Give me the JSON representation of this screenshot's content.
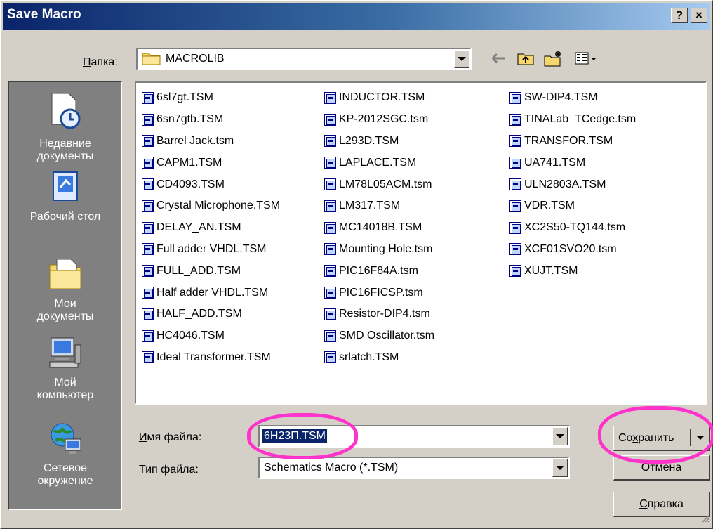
{
  "window": {
    "title": "Save Macro",
    "help_btn": "?",
    "close_btn": "×"
  },
  "folder": {
    "label_u": "П",
    "label_rest": "апка:",
    "value": "MACROLIB"
  },
  "toolbar": {
    "back_icon": "back-arrow-icon",
    "up_icon": "up-folder-icon",
    "new_folder_icon": "new-folder-icon",
    "view_icon": "view-menu-icon"
  },
  "places": [
    {
      "label_line1": "Недавние",
      "label_line2": "документы",
      "icon": "recent-documents-icon"
    },
    {
      "label_line1": "Рабочий стол",
      "label_line2": "",
      "icon": "desktop-icon"
    },
    {
      "label_line1": "Мои",
      "label_line2": "документы",
      "icon": "my-documents-icon"
    },
    {
      "label_line1": "Мой",
      "label_line2": "компьютер",
      "icon": "my-computer-icon"
    },
    {
      "label_line1": "Сетевое",
      "label_line2": "окружение",
      "icon": "network-icon"
    }
  ],
  "files": {
    "col1": [
      "6sl7gt.TSM",
      "6sn7gtb.TSM",
      "Barrel Jack.tsm",
      "CAPM1.TSM",
      "CD4093.TSM",
      "Crystal Microphone.TSM",
      "DELAY_AN.TSM",
      "Full adder VHDL.TSM",
      "FULL_ADD.TSM",
      "Half adder VHDL.TSM",
      "HALF_ADD.TSM",
      "HC4046.TSM",
      "Ideal Transformer.TSM"
    ],
    "col2": [
      "INDUCTOR.TSM",
      "KP-2012SGC.tsm",
      "L293D.TSM",
      "LAPLACE.TSM",
      "LM78L05ACM.tsm",
      "LM317.TSM",
      "MC14018B.TSM",
      "Mounting Hole.tsm",
      "PIC16F84A.tsm",
      "PIC16FICSP.tsm",
      "Resistor-DIP4.tsm",
      "SMD Oscillator.tsm",
      "srlatch.TSM"
    ],
    "col3": [
      "SW-DIP4.TSM",
      "TINALab_TCedge.tsm",
      "TRANSFOR.TSM",
      "UA741.TSM",
      "ULN2803A.TSM",
      "VDR.TSM",
      "XC2S50-TQ144.tsm",
      "XCF01SVO20.tsm",
      "XUJT.TSM"
    ]
  },
  "filename": {
    "label_u": "И",
    "label_rest": "мя файла:",
    "value": "6H23П.TSM"
  },
  "filetype": {
    "label_u": "Т",
    "label_rest": "ип файла:",
    "value": "Schematics Macro (*.TSM)"
  },
  "buttons": {
    "save_pre": "Со",
    "save_u": "х",
    "save_post": "ранить",
    "cancel": "Отмена",
    "help_u": "С",
    "help_rest": "правка"
  },
  "colors": {
    "annotation": "#ff33cc",
    "title_gradient_start": "#0a246a",
    "selection": "#0a246a"
  }
}
